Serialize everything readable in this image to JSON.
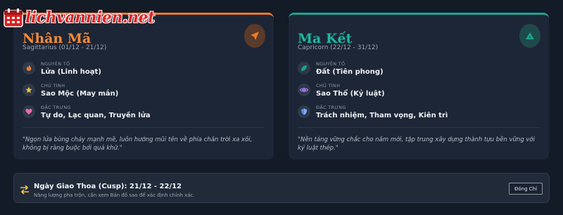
{
  "logo": {
    "text": "lichvannien.net"
  },
  "cards": [
    {
      "name": "Nhân Mã",
      "range": "Sagittarius (01/12 - 21/12)",
      "accent": "#f07b2c",
      "attributes": [
        {
          "label": "NGUYÊN TỐ",
          "value": "Lửa (Linh hoạt)",
          "icon": "fire-icon"
        },
        {
          "label": "CHỦ TINH",
          "value": "Sao Mộc (May mắn)",
          "icon": "star-icon"
        },
        {
          "label": "ĐẶC TRƯNG",
          "value": "Tự do, Lạc quan, Truyền lửa",
          "icon": "heart-icon"
        }
      ],
      "quote": "\"Ngọn lửa bùng cháy mạnh mẽ, luôn hướng mũi tên về phía chân trời xa xôi, không bị ràng buộc bởi quá khứ.\""
    },
    {
      "name": "Ma Kết",
      "range": "Capricorn (22/12 - 31/12)",
      "accent": "#1aa493",
      "attributes": [
        {
          "label": "NGUYÊN TỐ",
          "value": "Đất (Tiên phong)",
          "icon": "leaf-icon"
        },
        {
          "label": "CHỦ TINH",
          "value": "Sao Thổ (Kỷ luật)",
          "icon": "planet-icon"
        },
        {
          "label": "ĐẶC TRƯNG",
          "value": "Trách nhiệm, Tham vọng, Kiên trì",
          "icon": "shield-icon"
        }
      ],
      "quote": "\"Nền tảng vững chắc cho năm mới, tập trung xây dựng thành tựu bền vững với kỷ luật thép.\""
    }
  ],
  "cusp": {
    "title": "Ngày Giao Thoa (Cusp): 21/12 - 22/12",
    "subtitle": "Năng lượng pha trộn, cần xem Bản đồ sao để xác định chính xác.",
    "button": "Đóng Chỉ"
  }
}
